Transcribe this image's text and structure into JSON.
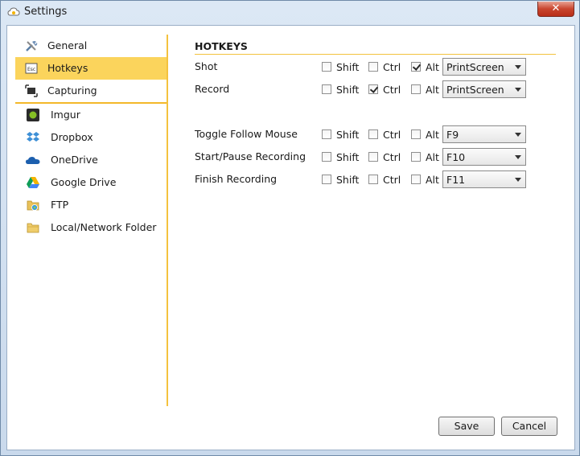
{
  "window": {
    "title": "Settings",
    "close_glyph": "✕"
  },
  "sidebar": {
    "items": [
      {
        "label": "General",
        "icon": "tools-icon",
        "active": false
      },
      {
        "label": "Hotkeys",
        "icon": "keyboard-key-icon",
        "active": true
      },
      {
        "label": "Capturing",
        "icon": "capture-icon",
        "active": false
      },
      {
        "label": "Imgur",
        "icon": "imgur-icon",
        "active": false
      },
      {
        "label": "Dropbox",
        "icon": "dropbox-icon",
        "active": false
      },
      {
        "label": "OneDrive",
        "icon": "onedrive-icon",
        "active": false
      },
      {
        "label": "Google Drive",
        "icon": "google-drive-icon",
        "active": false
      },
      {
        "label": "FTP",
        "icon": "ftp-icon",
        "active": false
      },
      {
        "label": "Local/Network Folder",
        "icon": "folder-icon",
        "active": false
      }
    ]
  },
  "hotkeys": {
    "title": "HOTKEYS",
    "modifiers": [
      "Shift",
      "Ctrl",
      "Alt"
    ],
    "rows": [
      {
        "name": "Shot",
        "shift": false,
        "ctrl": false,
        "alt": true,
        "key": "PrintScreen"
      },
      {
        "name": "Record",
        "shift": false,
        "ctrl": true,
        "alt": false,
        "key": "PrintScreen"
      },
      {
        "name": "Toggle Follow Mouse",
        "shift": false,
        "ctrl": false,
        "alt": false,
        "key": "F9"
      },
      {
        "name": "Start/Pause Recording",
        "shift": false,
        "ctrl": false,
        "alt": false,
        "key": "F10"
      },
      {
        "name": "Finish Recording",
        "shift": false,
        "ctrl": false,
        "alt": false,
        "key": "F11"
      }
    ]
  },
  "buttons": {
    "save": "Save",
    "cancel": "Cancel"
  },
  "colors": {
    "accent": "#fbd45c",
    "accent_line": "#f3c23e"
  }
}
